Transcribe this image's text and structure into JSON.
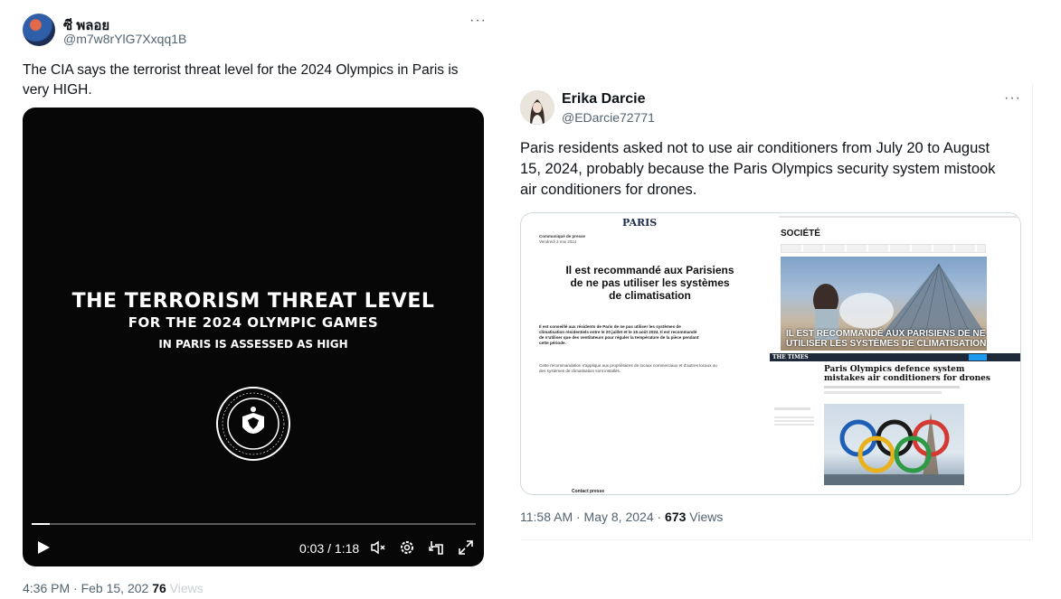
{
  "tweet1": {
    "name": "ซี พลอย",
    "handle": "@m7w8rYlG7Xxqq1B",
    "text_line1": "The CIA says the terrorist threat level for the 2024 Olympics in Paris is",
    "text_line2": "very HIGH.",
    "more": "···",
    "video": {
      "line1": "THE TERRORISM THREAT LEVEL",
      "line2": "FOR THE 2024 OLYMPIC GAMES",
      "line3": "IN PARIS IS ASSESSED AS HIGH",
      "time": "0:03 / 1:18",
      "progress_fraction": 0.04
    },
    "timestamp": "4:36 PM · Feb 15, 202",
    "views_count": "76",
    "views_label": "Views"
  },
  "tweet2": {
    "name": "Erika Darcie",
    "handle": "@EDarcie72771",
    "text_line1": "Paris residents asked not to use air conditioners from July 20 to August",
    "text_line2": "15, 2024, probably because the Paris Olympics security system mistook",
    "text_line3": "air conditioners for drones.",
    "more": "···",
    "timestamp": "11:58 AM · May 8, 2024 · ",
    "views_count": "673",
    "views_label": " Views",
    "media": {
      "paris_logo": "PARIS",
      "communique": "Communiqué de presse",
      "date": "Vendredi 3 mai 2024",
      "headline1": "Il est recommandé aux Parisiens",
      "headline2": "de ne pas utiliser les systèmes",
      "headline3": "de climatisation",
      "body1": "Il est conseillé aux résidents de Paris de ne pas utiliser les systèmes de",
      "body2": "climatisation résidentiels entre le 20 juillet et le 15 août 2024. Il est recommandé",
      "body3": "de n'utiliser que des ventilateurs pour réguler la température de la pièce pendant",
      "body4": "cette période.",
      "body5": "Cette recommandation s'applique aux propriétaires de locaux commerciaux et d'autres locaux ou",
      "body6": "des systèmes de climatisation sont installés.",
      "contact": "Contact presse",
      "societe": "SOCIÉTÉ",
      "overlay1": "IL EST RECOMMANDÉ AUX PARISIENS DE NE PAS",
      "overlay2": "UTILISER LES SYSTÈMES DE CLIMATISATION",
      "times_logo": "THE TIMES",
      "times_headline1": "Paris Olympics defence system",
      "times_headline2": "mistakes air conditioners for drones"
    }
  },
  "colors": {
    "text": "#0f1419",
    "muted": "#536471",
    "border": "#cfd9de"
  }
}
